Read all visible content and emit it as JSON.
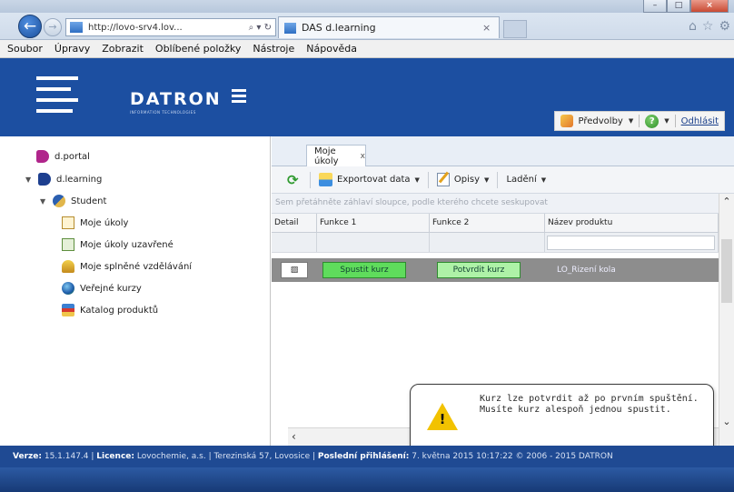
{
  "browser": {
    "url": "http://lovo-srv4.lov...",
    "url_tools": "⌕ ▾ ↻",
    "tab_title": "DAS d.learning",
    "tab_close": "×",
    "win_minimize": "–",
    "win_maximize": "□",
    "win_close": "×"
  },
  "menu": {
    "items": [
      "Soubor",
      "Úpravy",
      "Zobrazit",
      "Oblíbené položky",
      "Nástroje",
      "Nápověda"
    ]
  },
  "header": {
    "logo_word": "DATRON",
    "logo_sub": "INFORMATION TECHNOLOGIES",
    "preferences_label": "Předvolby",
    "logout_label": "Odhlásit",
    "help_symbol": "?"
  },
  "sidebar": {
    "items": [
      {
        "label": "d.portal",
        "icon": "portal-icon",
        "level": 0,
        "expanded": false
      },
      {
        "label": "d.learning",
        "icon": "learning-icon",
        "level": 0,
        "expanded": true
      },
      {
        "label": "Student",
        "icon": "student-icon",
        "level": 1,
        "expanded": true
      },
      {
        "label": "Moje úkoly",
        "icon": "tasks-icon",
        "level": 2
      },
      {
        "label": "Moje úkoly uzavřené",
        "icon": "closed-tasks-icon",
        "level": 2
      },
      {
        "label": "Moje splněné vzdělávání",
        "icon": "completed-education-icon",
        "level": 2
      },
      {
        "label": "Veřejné kurzy",
        "icon": "globe-icon",
        "level": 2
      },
      {
        "label": "Katalog produktů",
        "icon": "catalog-icon",
        "level": 2
      }
    ]
  },
  "content": {
    "tab_label": "Moje úkoly",
    "tab_close": "x",
    "toolbar": {
      "export_label": "Exportovat data",
      "opisy_label": "Opisy",
      "debug_label": "Ladění"
    },
    "group_hint": "Sem přetáhněte záhlaví sloupce, podle kterého chcete seskupovat",
    "columns": [
      "Detail",
      "Funkce 1",
      "Funkce 2",
      "Název produktu"
    ],
    "rows": [
      {
        "detail_icon": "▨",
        "function1": "Spustit kurz",
        "function2": "Potvrdit kurz",
        "product": "LO_Rizení kola"
      }
    ]
  },
  "notice": {
    "text": "Kurz lze potvrdit až po prvním spuštění. Musíte kurz alespoň jednou spustit.",
    "symbol": "!"
  },
  "footer": {
    "version_label": "Verze:",
    "version_value": "15.1.147.4",
    "licence_label": "Licence:",
    "licence_value": "Lovochemie, a.s. | Terezinská 57, Lovosice",
    "last_login_label": "Poslední přihlášení:",
    "last_login_value": "7. května 2015 10:17:22",
    "copyright": "© 2006 - 2015 DATRON"
  },
  "colors": {
    "brand_blue": "#1c4fa1",
    "run_button": "#5fdc5c",
    "confirm_button": "#aef2a7",
    "selected_row": "#8d8d8d"
  }
}
